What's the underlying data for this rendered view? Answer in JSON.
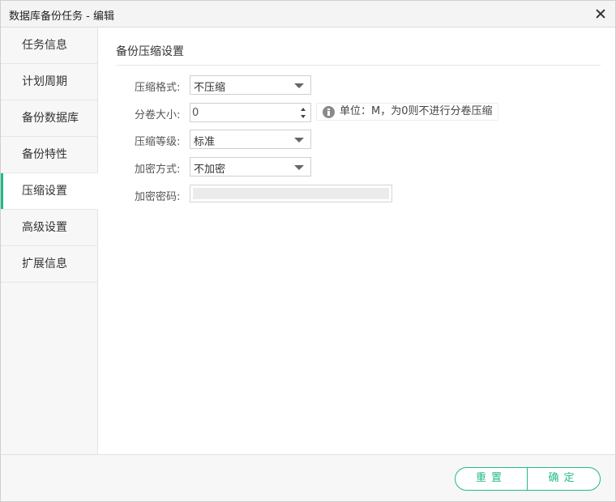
{
  "window": {
    "title": "数据库备份任务 - 编辑"
  },
  "sidebar": {
    "items": [
      {
        "label": "任务信息"
      },
      {
        "label": "计划周期"
      },
      {
        "label": "备份数据库"
      },
      {
        "label": "备份特性"
      },
      {
        "label": "压缩设置",
        "active": true
      },
      {
        "label": "高级设置"
      },
      {
        "label": "扩展信息"
      }
    ]
  },
  "section": {
    "title": "备份压缩设置"
  },
  "form": {
    "compress_format": {
      "label": "压缩格式:",
      "value": "不压缩"
    },
    "volume_size": {
      "label": "分卷大小:",
      "value": "0",
      "hint": "单位：M，为0则不进行分卷压缩"
    },
    "compress_level": {
      "label": "压缩等级:",
      "value": "标准"
    },
    "encrypt_method": {
      "label": "加密方式:",
      "value": "不加密"
    },
    "encrypt_password": {
      "label": "加密密码:",
      "value": ""
    }
  },
  "footer": {
    "reset_label": "重置",
    "ok_label": "确定"
  },
  "colors": {
    "accent": "#22b98a"
  },
  "icons": {
    "close": "close-icon",
    "info": "info-icon",
    "dropdown": "chevron-down-icon"
  }
}
